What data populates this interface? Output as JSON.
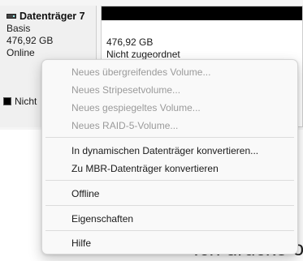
{
  "disk": {
    "title": "Datenträger 7",
    "type": "Basis",
    "size": "476,92 GB",
    "status": "Online"
  },
  "partition": {
    "size": "476,92 GB",
    "status": "Nicht zugeordnet"
  },
  "legend": {
    "label": "Nicht"
  },
  "background_text": "Ich drücke ol",
  "menu": {
    "items": [
      {
        "label": "Neues übergreifendes Volume...",
        "enabled": false
      },
      {
        "label": "Neues Stripesetvolume...",
        "enabled": false
      },
      {
        "label": "Neues gespiegeltes Volume...",
        "enabled": false
      },
      {
        "label": "Neues RAID-5-Volume...",
        "enabled": false
      },
      {
        "label": "In dynamischen Datenträger konvertieren...",
        "enabled": true
      },
      {
        "label": "Zu MBR-Datenträger konvertieren",
        "enabled": true
      },
      {
        "label": "Offline",
        "enabled": true
      },
      {
        "label": "Eigenschaften",
        "enabled": true
      },
      {
        "label": "Hilfe",
        "enabled": true
      }
    ]
  },
  "colors": {
    "unallocated_bar": "#000000",
    "menu_background": "#f9f9f9",
    "disabled_text": "#9a9a9a"
  },
  "icons": [
    "disk-icon"
  ]
}
